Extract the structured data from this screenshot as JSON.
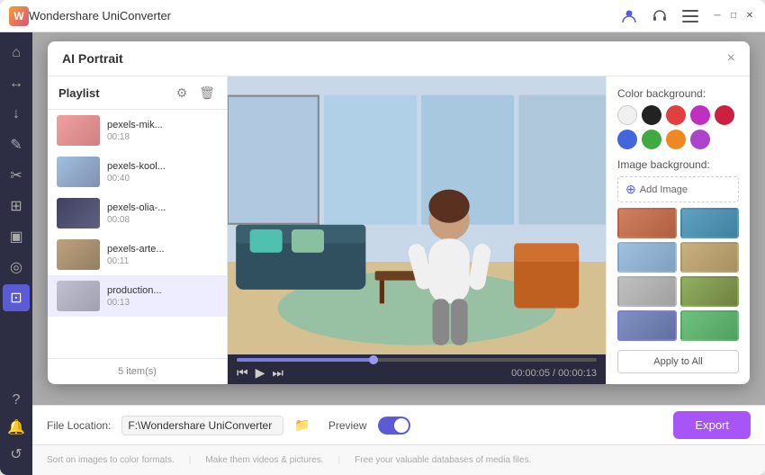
{
  "app": {
    "title": "Wondershare UniConverter",
    "logo_letter": "W"
  },
  "titlebar": {
    "icons": [
      "user-icon",
      "bell-icon",
      "menu-icon"
    ],
    "window_controls": [
      "minimize",
      "maximize",
      "close"
    ]
  },
  "sidebar": {
    "items": [
      {
        "id": "home",
        "icon": "⌂",
        "active": false
      },
      {
        "id": "convert",
        "icon": "↔",
        "active": false
      },
      {
        "id": "download",
        "icon": "↓",
        "active": false
      },
      {
        "id": "edit",
        "icon": "✎",
        "active": false
      },
      {
        "id": "scissor",
        "icon": "✂",
        "active": false
      },
      {
        "id": "merge",
        "icon": "⊞",
        "active": false
      },
      {
        "id": "tv",
        "icon": "▣",
        "active": false
      },
      {
        "id": "eye",
        "icon": "◎",
        "active": false
      },
      {
        "id": "grid",
        "icon": "⊡",
        "active": true
      }
    ],
    "bottom_items": [
      {
        "id": "help",
        "icon": "?"
      },
      {
        "id": "notification",
        "icon": "🔔"
      },
      {
        "id": "refresh",
        "icon": "↺"
      }
    ]
  },
  "dialog": {
    "title": "AI Portrait",
    "close_btn": "×"
  },
  "playlist": {
    "title": "Playlist",
    "items": [
      {
        "name": "pexels-mik...",
        "duration": "00:18",
        "thumb_class": "thumb-1",
        "active": false
      },
      {
        "name": "pexels-kool...",
        "duration": "00:40",
        "thumb_class": "thumb-2",
        "active": false
      },
      {
        "name": "pexels-olia-...",
        "duration": "00:08",
        "thumb_class": "thumb-3",
        "active": false
      },
      {
        "name": "pexels-arte...",
        "duration": "00:11",
        "thumb_class": "thumb-4",
        "active": false
      },
      {
        "name": "production...",
        "duration": "00:13",
        "thumb_class": "thumb-5",
        "active": true
      }
    ],
    "item_count": "5 item(s)"
  },
  "video": {
    "current_time": "00:00:05",
    "total_time": "00:00:13",
    "progress_percent": 38
  },
  "right_panel": {
    "color_bg_title": "Color background:",
    "colors": [
      {
        "value": "#f0f0f0",
        "label": "light-gray"
      },
      {
        "value": "#222222",
        "label": "black"
      },
      {
        "value": "#e04040",
        "label": "red"
      },
      {
        "value": "#c030c0",
        "label": "purple"
      },
      {
        "value": "#cc2040",
        "label": "dark-red"
      },
      {
        "value": "#4466dd",
        "label": "blue"
      },
      {
        "value": "#40aa40",
        "label": "green"
      },
      {
        "value": "#ee8820",
        "label": "orange"
      },
      {
        "value": "#aa44cc",
        "label": "violet"
      }
    ],
    "image_bg_title": "Image background:",
    "add_image_label": "Add Image",
    "image_thumbs": [
      {
        "class": "img-1"
      },
      {
        "class": "img-2"
      },
      {
        "class": "img-3"
      },
      {
        "class": "img-4"
      },
      {
        "class": "img-5"
      },
      {
        "class": "img-6"
      },
      {
        "class": "img-7 selected"
      },
      {
        "class": "img-8"
      }
    ],
    "apply_all_label": "Apply to All"
  },
  "bottom_bar": {
    "file_location_label": "File Location:",
    "file_location_value": "F:\\Wondershare UniConverter",
    "preview_label": "Preview",
    "export_label": "Export"
  },
  "footer": {
    "items": [
      {
        "text": "Sort on images to color\nformats."
      },
      {
        "text": "Make them videos &\npictures."
      },
      {
        "text": "Free your valuable databases\nof media files."
      }
    ]
  }
}
